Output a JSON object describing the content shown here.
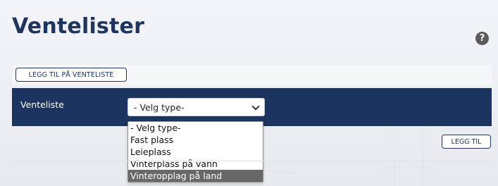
{
  "header": {
    "title": "Ventelister",
    "help_icon": "question-circle-icon"
  },
  "toolbar": {
    "add_to_waitlist_label": "LEGG TIL PÅ VENTELISTE"
  },
  "form": {
    "label": "Venteliste",
    "select": {
      "selected_value": "- Velg type-",
      "options": [
        "- Velg type-",
        "Fast plass",
        "Leieplass",
        "Vinterplass på vann",
        "Vinteropplag på land"
      ],
      "highlighted_option": "Vinteropplag på land"
    }
  },
  "actions": {
    "add_label": "LEGG TIL"
  },
  "colors": {
    "brand_navy": "#1c3560",
    "title_navy": "#1e3560",
    "highlight_gray": "#686868"
  }
}
